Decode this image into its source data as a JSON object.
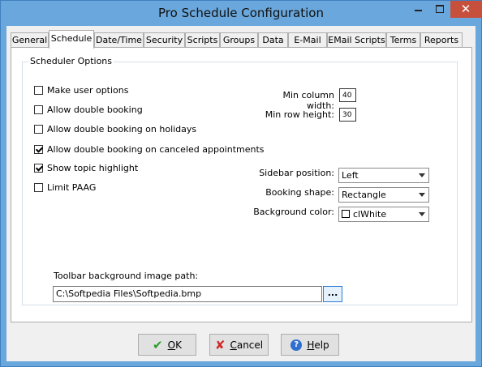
{
  "window": {
    "title": "Pro Schedule Configuration",
    "close_glyph": "✕"
  },
  "tabs": [
    {
      "label": "General"
    },
    {
      "label": "Schedule"
    },
    {
      "label": "Date/Time"
    },
    {
      "label": "Security"
    },
    {
      "label": "Scripts"
    },
    {
      "label": "Groups"
    },
    {
      "label": "Data"
    },
    {
      "label": "E-Mail"
    },
    {
      "label": "EMail Scripts"
    },
    {
      "label": "Terms"
    },
    {
      "label": "Reports"
    }
  ],
  "active_tab": "Schedule",
  "scheduler_options": {
    "group_title": "Scheduler Options",
    "checkboxes": [
      {
        "label": "Make user options",
        "checked": false
      },
      {
        "label": "Allow double booking",
        "checked": false
      },
      {
        "label": "Allow double booking on holidays",
        "checked": false
      },
      {
        "label": "Allow double booking on canceled appointments",
        "checked": true
      },
      {
        "label": "Show topic highlight",
        "checked": true
      },
      {
        "label": "Limit PAAG",
        "checked": false
      }
    ],
    "min_column_width": {
      "label": "Min column width:",
      "value": "40"
    },
    "min_row_height": {
      "label": "Min row height:",
      "value": "30"
    },
    "sidebar_position": {
      "label": "Sidebar position:",
      "value": "Left"
    },
    "booking_shape": {
      "label": "Booking shape:",
      "value": "Rectangle"
    },
    "background_color": {
      "label": "Background color:",
      "value": "clWhite",
      "swatch": "#ffffff"
    },
    "toolbar_image": {
      "label": "Toolbar background image path:",
      "value": "C:\\Softpedia Files\\Softpedia.bmp",
      "browse_label": "..."
    }
  },
  "buttons": {
    "ok": {
      "accel": "O",
      "rest": "K",
      "icon": "checkmark-icon",
      "color": "#2a9d2a"
    },
    "cancel": {
      "accel": "C",
      "rest": "ancel",
      "icon": "x-icon",
      "color": "#d02a2a"
    },
    "help": {
      "accel": "H",
      "rest": "elp",
      "icon": "help-icon",
      "glyph": "?",
      "color": "#2f6fd0"
    }
  }
}
